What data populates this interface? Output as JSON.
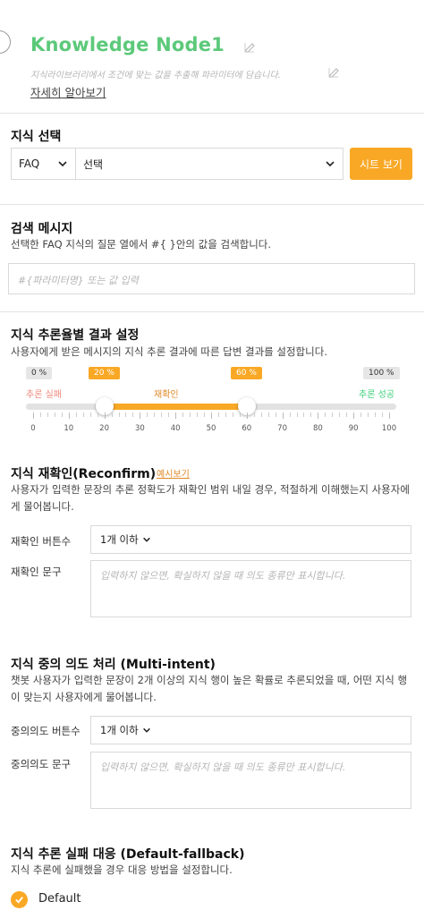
{
  "header": {
    "title": "Knowledge Node1",
    "description": "지식라이브러리에서 조건에 맞는 값을 추출해 파라미터에 담습니다.",
    "more_link": "자세히 알아보기",
    "icons": [
      "vertical-dots-icon",
      "edit-icon"
    ]
  },
  "knowledge_select": {
    "title": "지식 선택",
    "type_value": "FAQ",
    "item_value": "선택",
    "sheet_button": "시트 보기"
  },
  "search_message": {
    "title": "검색 메시지",
    "description": "선택한 FAQ 지식의 질문 열에서 #{ }안의 값을 검색합니다.",
    "placeholder": "#{파라미터명} 또는 값 입력"
  },
  "inference": {
    "title": "지식 추론율별 결과 설정",
    "description": "사용자에게 받은 메시지의 지식 추론 결과에 따른 답변 결과를 설정합니다.",
    "min_badge": "0 %",
    "low_badge": "20 %",
    "high_badge": "60 %",
    "max_badge": "100 %",
    "low_threshold": 20,
    "high_threshold": 60,
    "fail_label": "추론 실패",
    "reconfirm_label": "재확인",
    "success_label": "추론 성공",
    "ticks": [
      "0",
      "10",
      "20",
      "30",
      "40",
      "50",
      "60",
      "70",
      "80",
      "90",
      "100"
    ],
    "colors": {
      "accent": "#f9a825",
      "fail": "#f08a7e",
      "success": "#3ecf7b"
    }
  },
  "reconfirm": {
    "title": "지식 재확인(Reconfirm)",
    "example_link": "예시보기",
    "description": "사용자가 입력한 문장의 추론 정확도가 재확인 범위 내일 경우, 적절하게 이해했는지 사용자에게 물어봅니다.",
    "button_count_label": "재확인 버튼수",
    "button_count_value": "1개 이하",
    "sentence_label": "재확인 문구",
    "sentence_placeholder": "입력하지 않으면, 확실하지 않을 때 의도 종류만 표시합니다."
  },
  "multi_intent": {
    "title": "지식 중의 의도 처리 (Multi-intent)",
    "description": "챗봇 사용자가 입력한 문장이 2개 이상의 지식 행이 높은 확률로 추론되었을 때, 어떤 지식 행이 맞는지 사용자에게 물어봅니다.",
    "button_count_label": "중의의도 버튼수",
    "button_count_value": "1개 이하",
    "sentence_label": "중의의도 문구",
    "sentence_placeholder": "입력하지 않으면, 확실하지 않을 때 의도 종류만 표시합니다."
  },
  "fallback": {
    "title": "지식 추론 실패 대응 (Default-fallback)",
    "description": "지식 추론에 실패했을 경우 대응 방법을 설정합니다.",
    "option_label": "Default",
    "option_checked": true
  }
}
